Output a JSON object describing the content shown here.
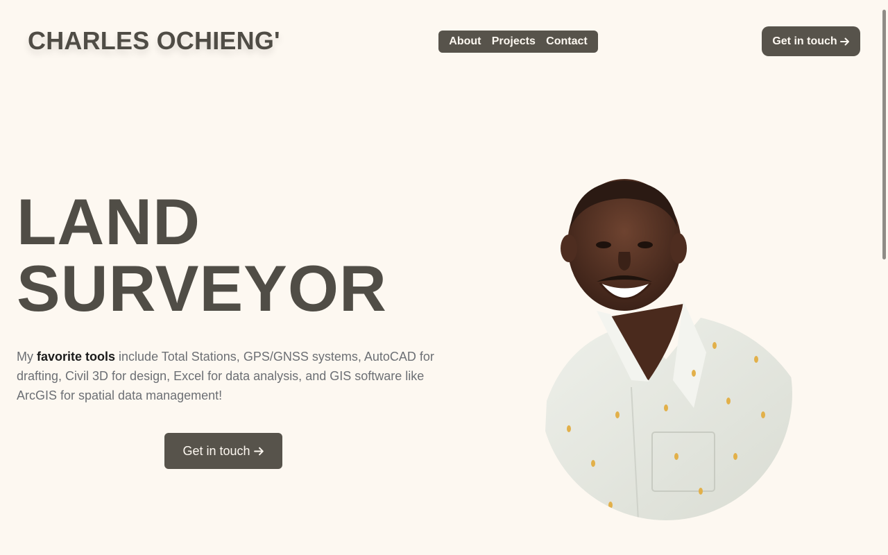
{
  "header": {
    "brand": "CHARLES OCHIENG'",
    "nav": [
      "About",
      "Projects",
      "Contact"
    ],
    "cta_label": "Get in touch",
    "cta_icon": "arrow-right-icon"
  },
  "hero": {
    "title_line1": "LAND",
    "title_line2": "SURVEYOR",
    "text_before": "My ",
    "text_bold": "favorite tools",
    "text_after": " include Total Stations, GPS/GNSS systems, AutoCAD for drafting, Civil 3D for design, Excel for data analysis, and GIS software like ArcGIS for spatial data management!",
    "cta_label": "Get in touch",
    "cta_icon": "arrow-right-icon"
  },
  "colors": {
    "background": "#fdf8f1",
    "primary": "#57534b",
    "heading": "#504d46",
    "body_text": "#6c6f74"
  }
}
